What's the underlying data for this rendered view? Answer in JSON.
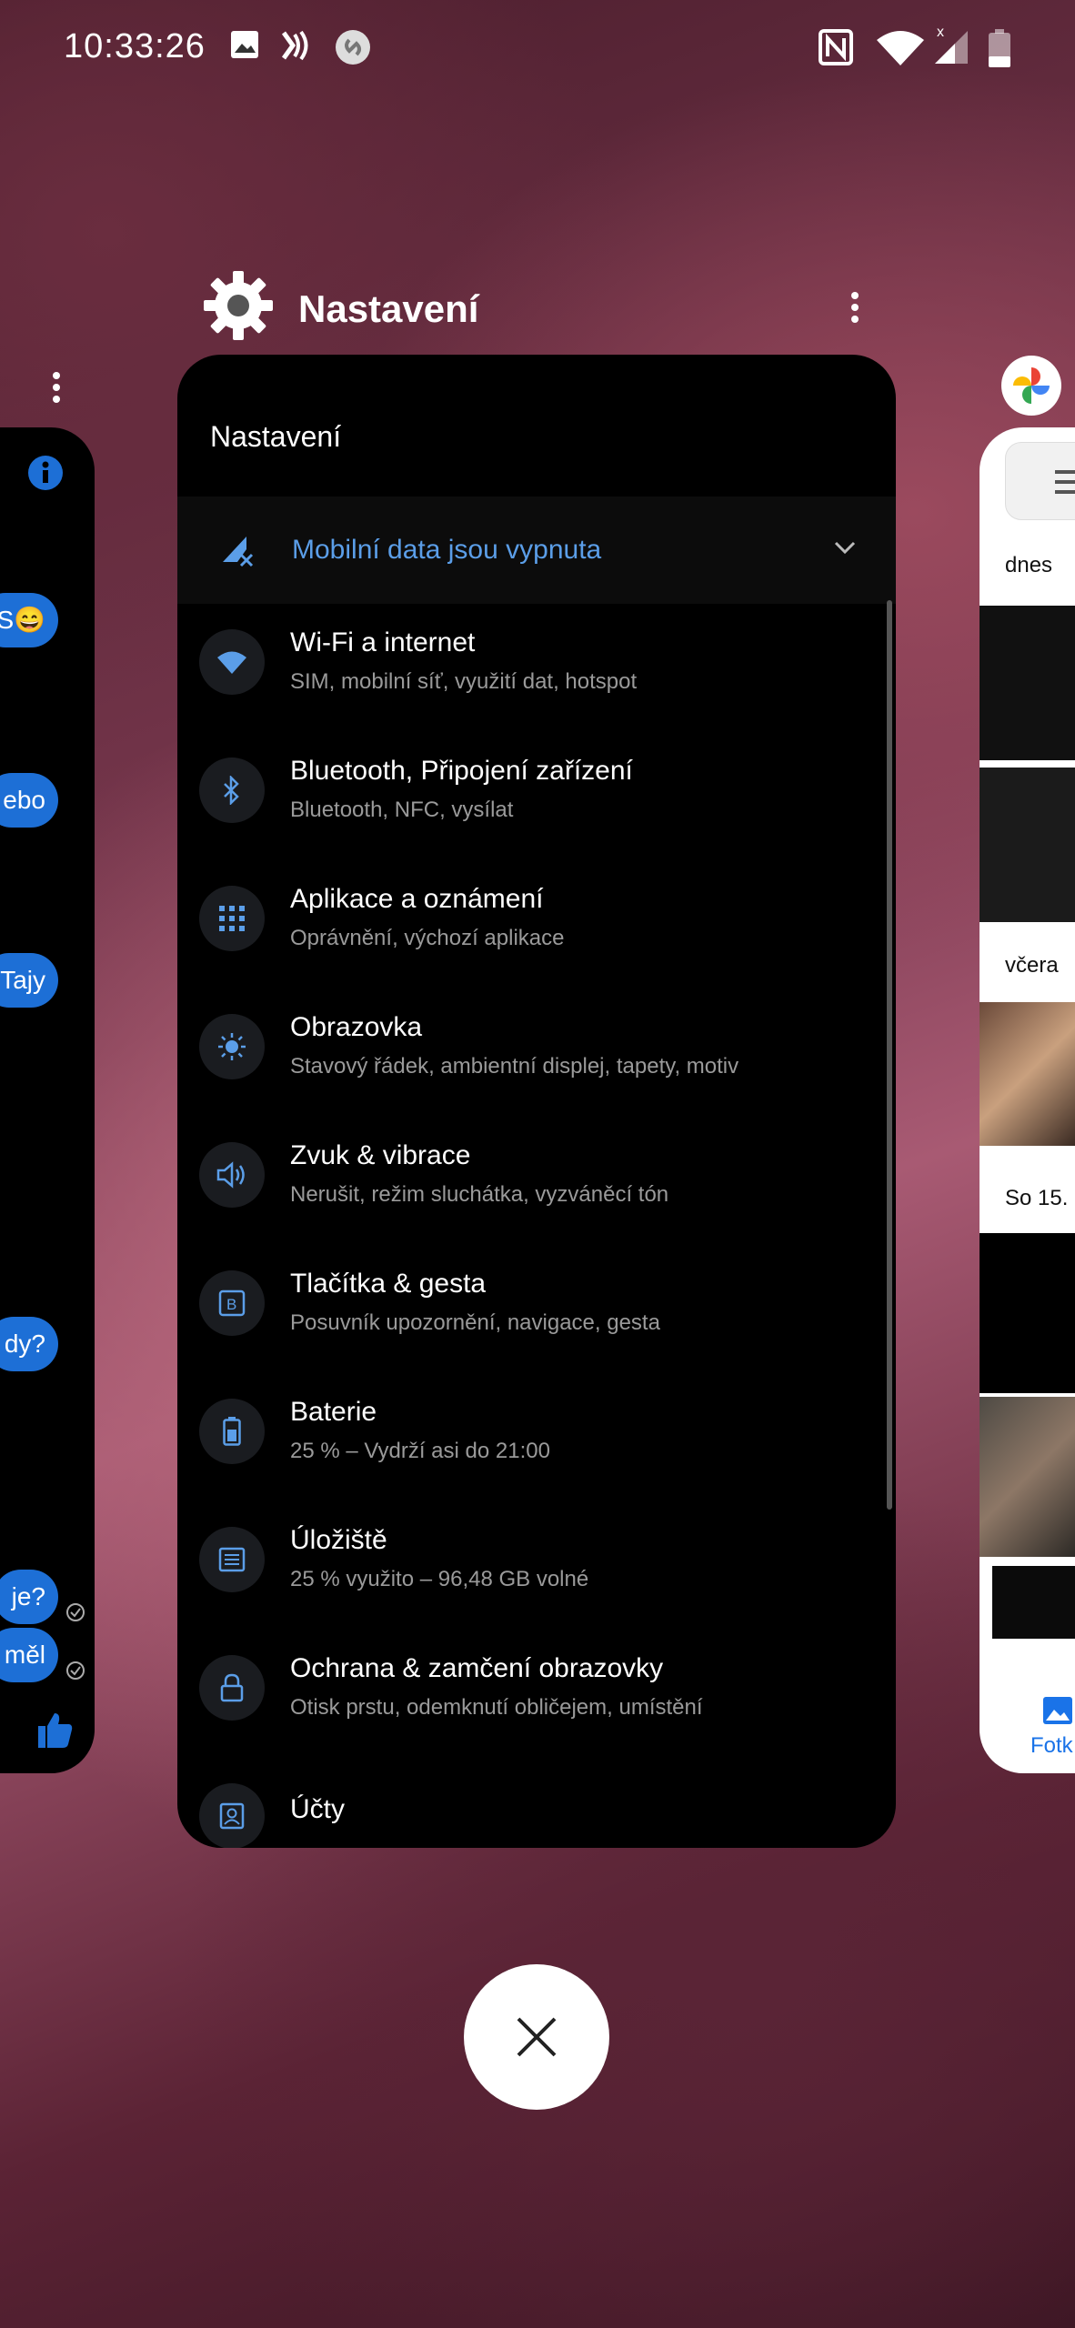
{
  "status_bar": {
    "time": "10:33:26",
    "left_icons": [
      "image-icon",
      "nfc-pay-icon",
      "shazam-icon"
    ],
    "right_icons": [
      "nfc-icon",
      "wifi-icon",
      "signal-icon",
      "battery-icon"
    ]
  },
  "app_header": {
    "title": "Nastavení",
    "icon": "gear-icon"
  },
  "settings": {
    "title": "Nastavení",
    "banner": "Mobilní data jsou vypnuta",
    "items": [
      {
        "title": "Wi-Fi a internet",
        "subtitle": "SIM, mobilní síť, využití dat, hotspot",
        "icon": "wifi-icon"
      },
      {
        "title": "Bluetooth, Připojení zařízení",
        "subtitle": "Bluetooth, NFC, vysílat",
        "icon": "bluetooth-icon"
      },
      {
        "title": "Aplikace a oznámení",
        "subtitle": "Oprávnění, výchozí aplikace",
        "icon": "apps-grid-icon"
      },
      {
        "title": "Obrazovka",
        "subtitle": "Stavový řádek, ambientní displej, tapety, motiv",
        "icon": "brightness-icon"
      },
      {
        "title": "Zvuk & vibrace",
        "subtitle": "Nerušit, režim sluchátka, vyzváněcí tón",
        "icon": "volume-icon"
      },
      {
        "title": "Tlačítka & gesta",
        "subtitle": "Posuvník upozornění, navigace, gesta",
        "icon": "button-b-icon"
      },
      {
        "title": "Baterie",
        "subtitle": "25 % – Vydrží asi do 21:00",
        "icon": "battery-icon"
      },
      {
        "title": "Úložiště",
        "subtitle": "25 % využito – 96,48 GB volné",
        "icon": "storage-icon"
      },
      {
        "title": "Ochrana & zamčení obrazovky",
        "subtitle": "Otisk prstu, odemknutí obličejem, umístění",
        "icon": "lock-icon"
      },
      {
        "title": "Účty",
        "subtitle": "",
        "icon": "account-icon"
      }
    ]
  },
  "left_card": {
    "bubbles": [
      "S😄",
      "ebo",
      "Tajy",
      "dy?",
      "je?",
      "měl"
    ]
  },
  "right_card": {
    "labels": [
      "dnes",
      "včera",
      "So 15.",
      "Fotk"
    ]
  },
  "colors": {
    "accent_blue": "#5b9ee8",
    "card_bg": "#000000",
    "icon_circle": "#1a1c20",
    "subtitle_gray": "#9a9a9a"
  }
}
